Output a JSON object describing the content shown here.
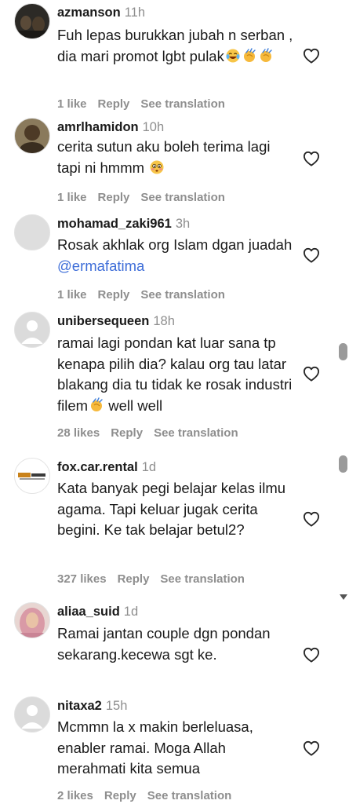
{
  "comments": [
    {
      "username": "azmanson",
      "time": "11h",
      "text": "Fuh lepas burukkan jubah n serban , dia mari promot lgbt pulak",
      "emojis": [
        "laughing-crying",
        "clapping",
        "clapping"
      ],
      "likes": "1 like",
      "reply": "Reply",
      "translate": "See translation",
      "avatar": "photo-dark"
    },
    {
      "username": "amrlhamidon",
      "time": "10h",
      "text": "cerita sutun aku boleh terima lagi tapi ni hmmm",
      "emojis": [
        "flushed"
      ],
      "likes": "1 like",
      "reply": "Reply",
      "translate": "See translation",
      "avatar": "photo-brown"
    },
    {
      "username": "mohamad_zaki961",
      "time": "3h",
      "text": "Rosak akhlak org Islam dgan juadah",
      "mention": "@ermafatima",
      "likes": "1 like",
      "reply": "Reply",
      "translate": "See translation",
      "avatar": "blank"
    },
    {
      "username": "unibersequeen",
      "time": "18h",
      "text": "ramai lagi pondan kat luar sana tp kenapa pilih dia? kalau org tau latar blakang dia tu tidak ke rosak industri filem",
      "emojis_inline": [
        "clapping"
      ],
      "text_after": "well well",
      "likes": "28 likes",
      "reply": "Reply",
      "translate": "See translation",
      "avatar": "default-person"
    },
    {
      "username": "fox.car.rental",
      "time": "1d",
      "text": "Kata banyak pegi belajar kelas ilmu agama. Tapi keluar jugak cerita begini. Ke tak belajar betul2?",
      "likes": "327 likes",
      "reply": "Reply",
      "translate": "See translation",
      "avatar": "logo-fox"
    },
    {
      "username": "aliaa_suid",
      "time": "1d",
      "text": "Ramai jantan couple dgn pondan sekarang.kecewa sgt ke.",
      "likes": "",
      "reply": "",
      "translate": "",
      "avatar": "photo-hijab"
    },
    {
      "username": "nitaxa2",
      "time": "15h",
      "text": "Mcmmn la x makin berleluasa, enabler ramai. Moga Allah merahmati kita semua",
      "likes": "2 likes",
      "reply": "Reply",
      "translate": "See translation",
      "avatar": "default-person"
    }
  ],
  "icons": {
    "like": "heart-outline-icon",
    "reply_scroll": "scrollbar-thumb"
  },
  "colors": {
    "username": "#1a1a1a",
    "meta": "#8e8e8e",
    "mention": "#3d6dd8",
    "avatar_bg": "#dbdbdb"
  }
}
